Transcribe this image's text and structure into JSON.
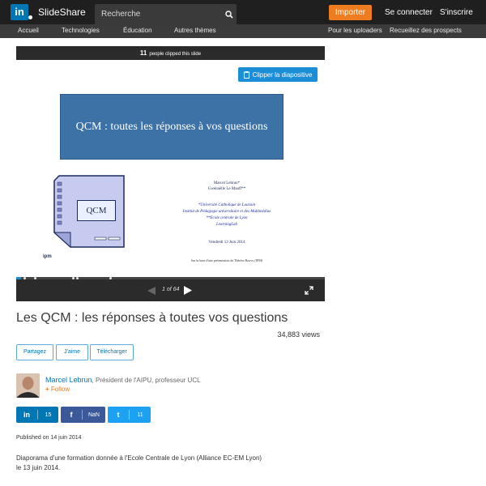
{
  "header": {
    "logo_text": "in",
    "brand": "SlideShare",
    "search_placeholder": "Recherche",
    "importer_label": "Importer",
    "login_label": "Se connecter",
    "signup_label": "S'inscrire"
  },
  "nav": {
    "left": [
      "Accueil",
      "Technologies",
      "Éducation",
      "Autres thèmes"
    ],
    "right": [
      "Pour les uploaders",
      "Recueillez des prospects"
    ]
  },
  "viewer": {
    "clip_count": "11",
    "clip_text": "people clipped this slide",
    "clip_button": "Clipper la diapositive",
    "page_current": "1",
    "page_total": "64",
    "page_sep": "of",
    "progress_fraction": 0.016
  },
  "slide": {
    "title": "QCM : toutes les réponses à vos questions",
    "qcm_label": "QCM",
    "ipm_logo": "ipm",
    "authors": [
      "Marcel Lebrun*",
      "Gwénaëlle Le Mauff**"
    ],
    "affiliations": [
      "*Université Catholique de Louvain",
      "Institut de Pédagogie universitaire et des Multimédias",
      "**Ecole centrale de Lyon",
      "LearningLab"
    ],
    "date": "Vendredi 13 Juin 2014",
    "footnote": "Sur la base d'une présentation de Thérèse Bouvy (IPM)"
  },
  "document": {
    "title": "Les QCM : les réponses à toutes vos questions",
    "views": "34,883 views",
    "actions": [
      "Partagez",
      "J'aime",
      "Télécharger"
    ],
    "author_name": "Marcel Lebrun",
    "author_role": ", Président de l'AIPU, professeur UCL",
    "follow_label": "Follow",
    "share": [
      {
        "icon": "in",
        "count": "15",
        "color": "#0077b5"
      },
      {
        "icon": "f",
        "count": "NaN",
        "color": "#3b5998"
      },
      {
        "icon": "t",
        "count": "11",
        "color": "#1da1f2"
      }
    ],
    "published": "Published on 14 juin 2014",
    "description": "Diaporama d'une formation donnée à l'Ecole Centrale de Lyon (Alliance EC-EM Lyon) le 13 juin 2014."
  }
}
